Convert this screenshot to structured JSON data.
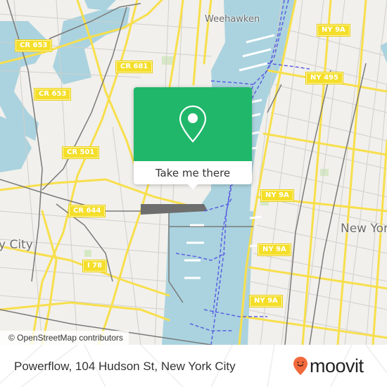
{
  "map": {
    "attribution": "© OpenStreetMap contributors",
    "colors": {
      "land": "#f2f0ec",
      "water": "#aad3df",
      "road_major": "#f7df4c",
      "road_minor": "#c8c8c8",
      "rail": "#7a7a7a",
      "ferry": "#5b5fe0",
      "park": "#d6e8c6"
    },
    "place_labels": [
      {
        "id": "weehawken",
        "text": "Weehawken"
      },
      {
        "id": "new-york",
        "text": "New York"
      },
      {
        "id": "jersey-city",
        "text": "y City"
      }
    ],
    "road_shields": [
      {
        "id": "cr653-a",
        "text": "CR 653"
      },
      {
        "id": "cr653-b",
        "text": "CR 653"
      },
      {
        "id": "cr681",
        "text": "CR 681"
      },
      {
        "id": "cr501",
        "text": "CR 501"
      },
      {
        "id": "cr644",
        "text": "CR 644"
      },
      {
        "id": "i78",
        "text": "I 78"
      },
      {
        "id": "ny9a-a",
        "text": "NY 9A"
      },
      {
        "id": "ny495",
        "text": "NY 495"
      },
      {
        "id": "ny9a-b",
        "text": "NY 9A"
      },
      {
        "id": "ny9a-c",
        "text": "NY 9A"
      },
      {
        "id": "ny9a-d",
        "text": "NY 9A"
      }
    ]
  },
  "popup": {
    "icon": "map-pin-icon",
    "accent": "#20b76a",
    "button_label": "Take me there"
  },
  "footer": {
    "address": "Powerflow, 104 Hudson St, New York City",
    "brand": {
      "name": "moovit",
      "icon": "moovit-smiley-pin-icon",
      "color": "#f26a3c"
    }
  }
}
